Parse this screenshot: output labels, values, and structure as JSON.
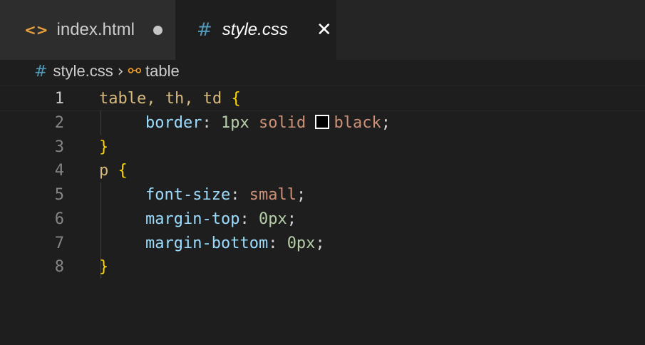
{
  "tabs": [
    {
      "label": "index.html",
      "icon": "html-code-icon",
      "dirty": true
    },
    {
      "label": "style.css",
      "icon": "css-hash-icon",
      "active": true,
      "close": "✕"
    }
  ],
  "breadcrumb": {
    "file": "style.css",
    "separator": "›",
    "symbol": "table"
  },
  "editor": {
    "lines": [
      {
        "num": "1",
        "sel": "table, th, td",
        "brace": "{"
      },
      {
        "num": "2",
        "prop": "border",
        "num_val": "1px",
        "val1": "solid",
        "color_name": "black",
        "swatch_color": "#000000"
      },
      {
        "num": "3",
        "brace": "}"
      },
      {
        "num": "4",
        "sel": "p",
        "brace": "{"
      },
      {
        "num": "5",
        "prop": "font-size",
        "val": "small"
      },
      {
        "num": "6",
        "prop": "margin-top",
        "num_val": "0px"
      },
      {
        "num": "7",
        "prop": "margin-bottom",
        "num_val": "0px"
      },
      {
        "num": "8",
        "brace": "}"
      }
    ]
  },
  "colors": {
    "background": "#1e1e1e",
    "selector": "#d7ba7d",
    "property": "#9cdcfe",
    "number": "#b5cea8",
    "string_value": "#ce9178",
    "bracket": "#ffd700",
    "css_icon": "#519aba",
    "html_icon": "#e9a23b"
  }
}
